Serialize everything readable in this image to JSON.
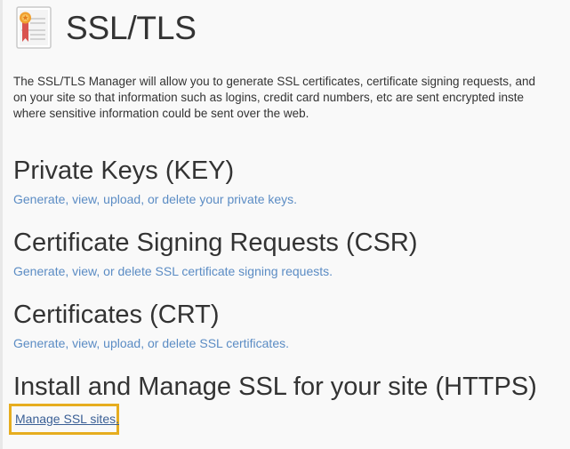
{
  "header": {
    "title": "SSL/TLS",
    "icon": "certificate-icon"
  },
  "intro": {
    "line1": "The SSL/TLS Manager will allow you to generate SSL certificates, certificate signing requests, and",
    "line2": "on your site so that information such as logins, credit card numbers, etc are sent encrypted inste",
    "line3": "where sensitive information could be sent over the web."
  },
  "sections": {
    "private_keys": {
      "heading": "Private Keys (KEY)",
      "link": "Generate, view, upload, or delete your private keys."
    },
    "csr": {
      "heading": "Certificate Signing Requests (CSR)",
      "link": "Generate, view, or delete SSL certificate signing requests."
    },
    "crt": {
      "heading": "Certificates (CRT)",
      "link": "Generate, view, upload, or delete SSL certificates."
    },
    "install": {
      "heading": "Install and Manage SSL for your site (HTTPS)",
      "link": "Manage SSL sites."
    }
  },
  "colors": {
    "link": "#5b8cc4",
    "highlight": "#e6ad1f",
    "heading": "#333333"
  }
}
